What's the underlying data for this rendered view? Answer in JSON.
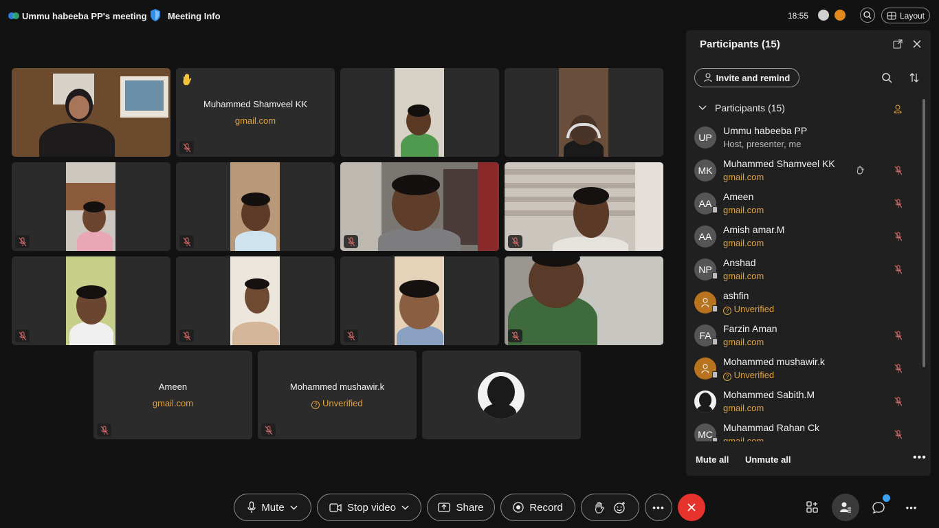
{
  "topbar": {
    "meeting_title": "Ummu habeeba  PP's meeting",
    "meeting_info": "Meeting Info",
    "time": "18:55",
    "layout_label": "Layout"
  },
  "tiles": {
    "t2_name": "Muhammed Shamveel KK",
    "t2_sub": "gmail.com",
    "t14_name": "Ameen",
    "t14_sub": "gmail.com",
    "t15_name": "Mohammed mushawir.k",
    "t15_sub": "Unverified"
  },
  "panel": {
    "title": "Participants (15)",
    "invite_label": "Invite and remind",
    "group_label": "Participants (15)",
    "participants": [
      {
        "initials": "UP",
        "name": "Ummu habeeba  PP",
        "sub": "Host, presenter, me"
      },
      {
        "initials": "MK",
        "name": "Muhammed Shamveel KK",
        "sub": "gmail.com"
      },
      {
        "initials": "AA",
        "name": "Ameen",
        "sub": "gmail.com"
      },
      {
        "initials": "AA",
        "name": "Amish amar.M",
        "sub": "gmail.com"
      },
      {
        "initials": "NP",
        "name": "Anshad",
        "sub": "gmail.com"
      },
      {
        "initials": "",
        "name": "ashfin",
        "sub": "Unverified"
      },
      {
        "initials": "FA",
        "name": "Farzin Aman",
        "sub": "gmail.com"
      },
      {
        "initials": "",
        "name": "Mohammed mushawir.k",
        "sub": "Unverified"
      },
      {
        "initials": "",
        "name": "Mohammed Sabith.M",
        "sub": "gmail.com"
      },
      {
        "initials": "MC",
        "name": "Muhammad Rahan Ck",
        "sub": "gmail.com"
      }
    ],
    "mute_all": "Mute all",
    "unmute_all": "Unmute all"
  },
  "controls": {
    "mute": "Mute",
    "stop_video": "Stop video",
    "share": "Share",
    "record": "Record"
  },
  "colors": {
    "accent_orange": "#e0a23a",
    "leave_red": "#e5322d",
    "muted_icon": "#e06c6c"
  }
}
